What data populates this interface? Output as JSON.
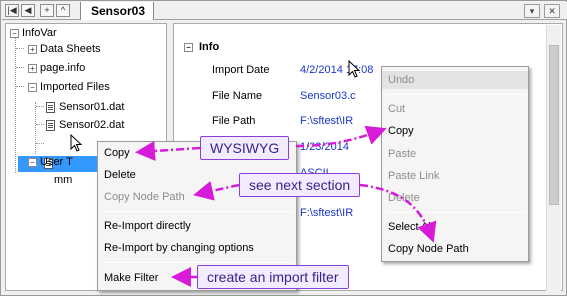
{
  "tab": {
    "title": "Sensor03"
  },
  "tabstrip": {
    "nav_labels": [
      "|◀",
      "◀",
      "+",
      "^"
    ],
    "window_buttons": [
      "▾",
      "✕"
    ]
  },
  "tree": {
    "root": "InfoVar",
    "items": [
      {
        "label": "Data Sheets",
        "expander": "+"
      },
      {
        "label": "page.info",
        "expander": "+"
      },
      {
        "label": "Imported Files",
        "expander": "−"
      },
      {
        "label": "Sensor01.dat"
      },
      {
        "label": "Sensor02.dat"
      },
      {
        "label": "User T"
      },
      {
        "label": "mm"
      }
    ]
  },
  "right_pane": {
    "section": {
      "label": "Info",
      "expander": "−"
    },
    "properties": [
      {
        "label": "Import Date",
        "value": "4/2/2014 17:08"
      },
      {
        "label": "File Name",
        "value": "Sensor03.c"
      },
      {
        "label": "File Path",
        "value": "F:\\sftest\\IR"
      },
      {
        "label": "",
        "value": "1/23/2014"
      },
      {
        "label": "",
        "value": "ASCII"
      },
      {
        "label": "",
        "value": "F:\\sftest\\IR"
      }
    ]
  },
  "left_menu": {
    "items": [
      {
        "label": "Copy",
        "disabled": false
      },
      {
        "label": "Delete",
        "disabled": false
      },
      {
        "label": "Copy Node Path",
        "disabled": true
      },
      {
        "label": "Re-Import directly",
        "disabled": false
      },
      {
        "label": "Re-Import by changing options",
        "disabled": false
      },
      {
        "label": "Make Filter",
        "disabled": false
      }
    ]
  },
  "right_menu": {
    "items": [
      {
        "label": "Undo",
        "disabled": true
      },
      {
        "label": "Cut",
        "disabled": true
      },
      {
        "label": "Copy",
        "disabled": false
      },
      {
        "label": "Paste",
        "disabled": true
      },
      {
        "label": "Paste Link",
        "disabled": true
      },
      {
        "label": "Delete",
        "disabled": true
      },
      {
        "label": "Select All",
        "disabled": false
      },
      {
        "label": "Copy Node Path",
        "disabled": false
      }
    ]
  },
  "callouts": {
    "wysiwyg": "WYSIWYG",
    "see_next": "see next section",
    "import_filter": "create an import filter"
  },
  "colors": {
    "callout_border": "#8a3fd6",
    "arrow": "#d81bd8",
    "value_text": "#1a36c8",
    "selection": "#3399ff"
  }
}
